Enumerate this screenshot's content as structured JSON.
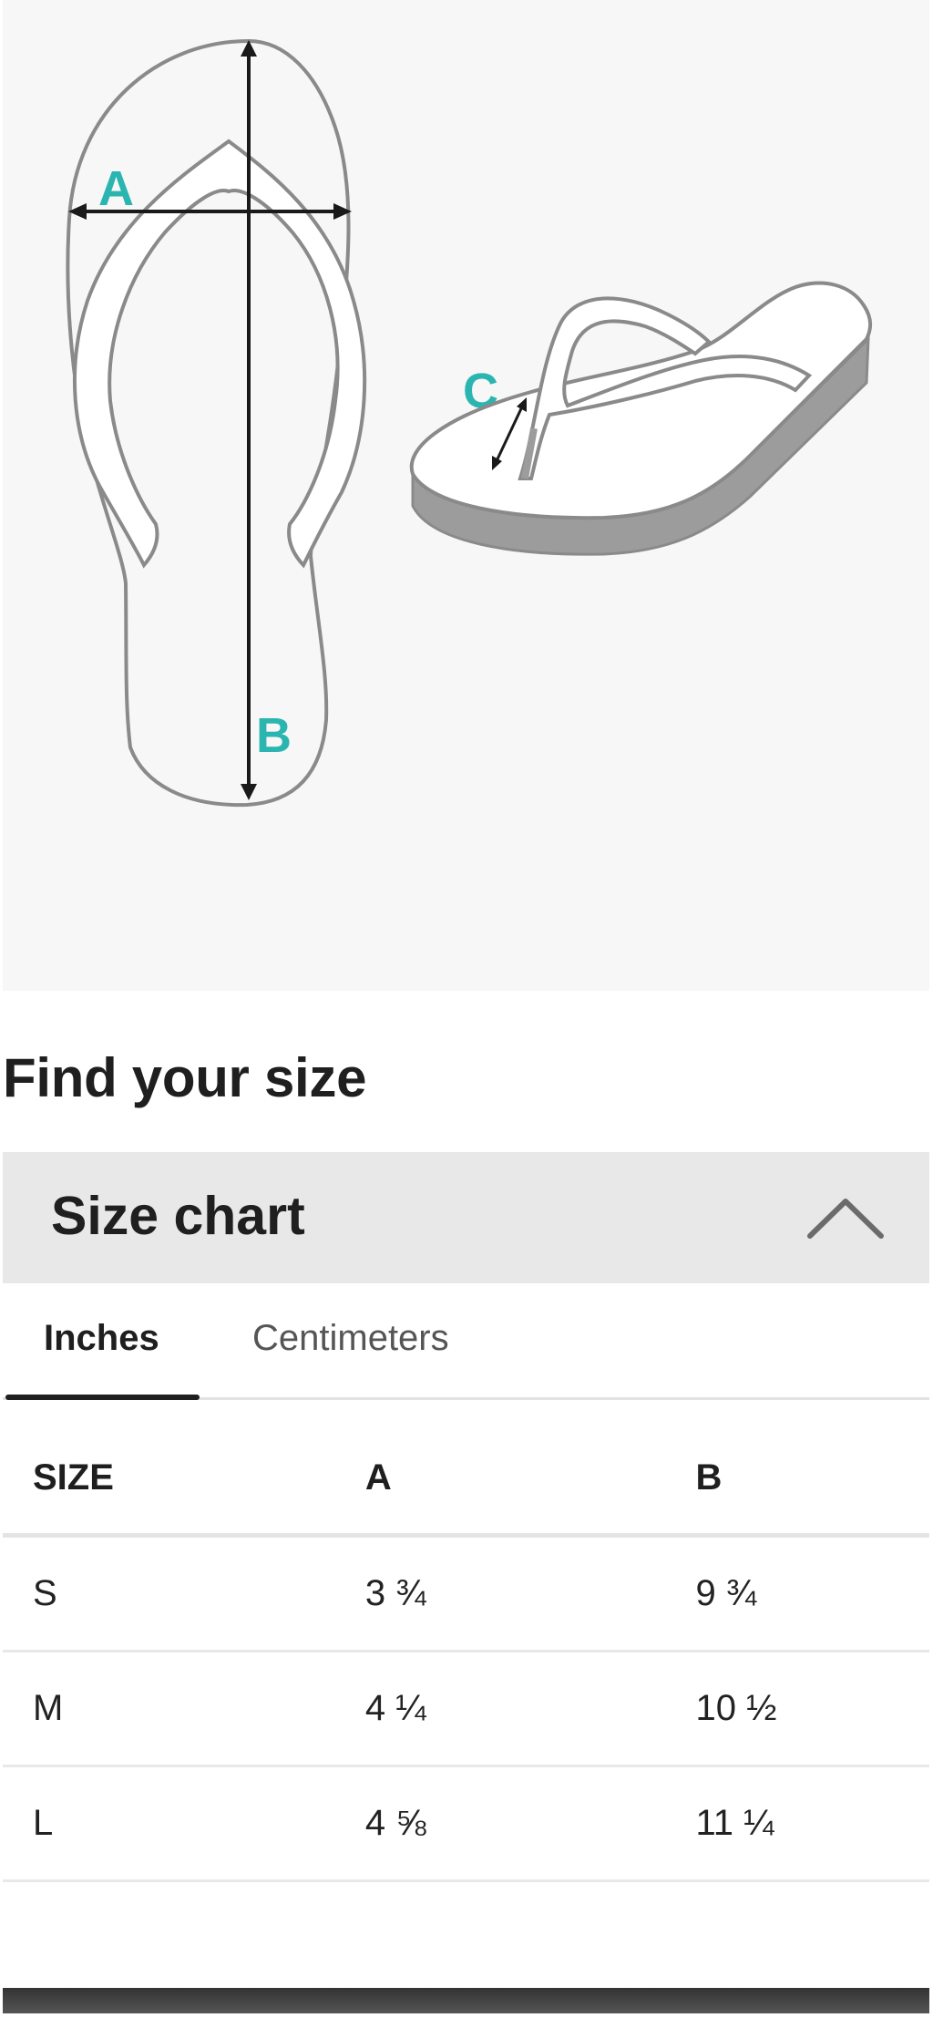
{
  "diagram": {
    "labels": {
      "a": "A",
      "b": "B",
      "c": "C"
    },
    "accent_color": "#2bb5b0"
  },
  "section_title": "Find your size",
  "accordion": {
    "title": "Size chart",
    "expanded": true,
    "icon": "chevron-up-icon"
  },
  "tabs": [
    {
      "label": "Inches",
      "active": true
    },
    {
      "label": "Centimeters",
      "active": false
    }
  ],
  "table": {
    "headers": [
      "SIZE",
      "A",
      "B"
    ],
    "rows": [
      [
        "S",
        "3 ¾",
        "9 ¾"
      ],
      [
        "M",
        "4 ¼",
        "10 ½"
      ],
      [
        "L",
        "4 ⅝",
        "11 ¼"
      ]
    ]
  }
}
